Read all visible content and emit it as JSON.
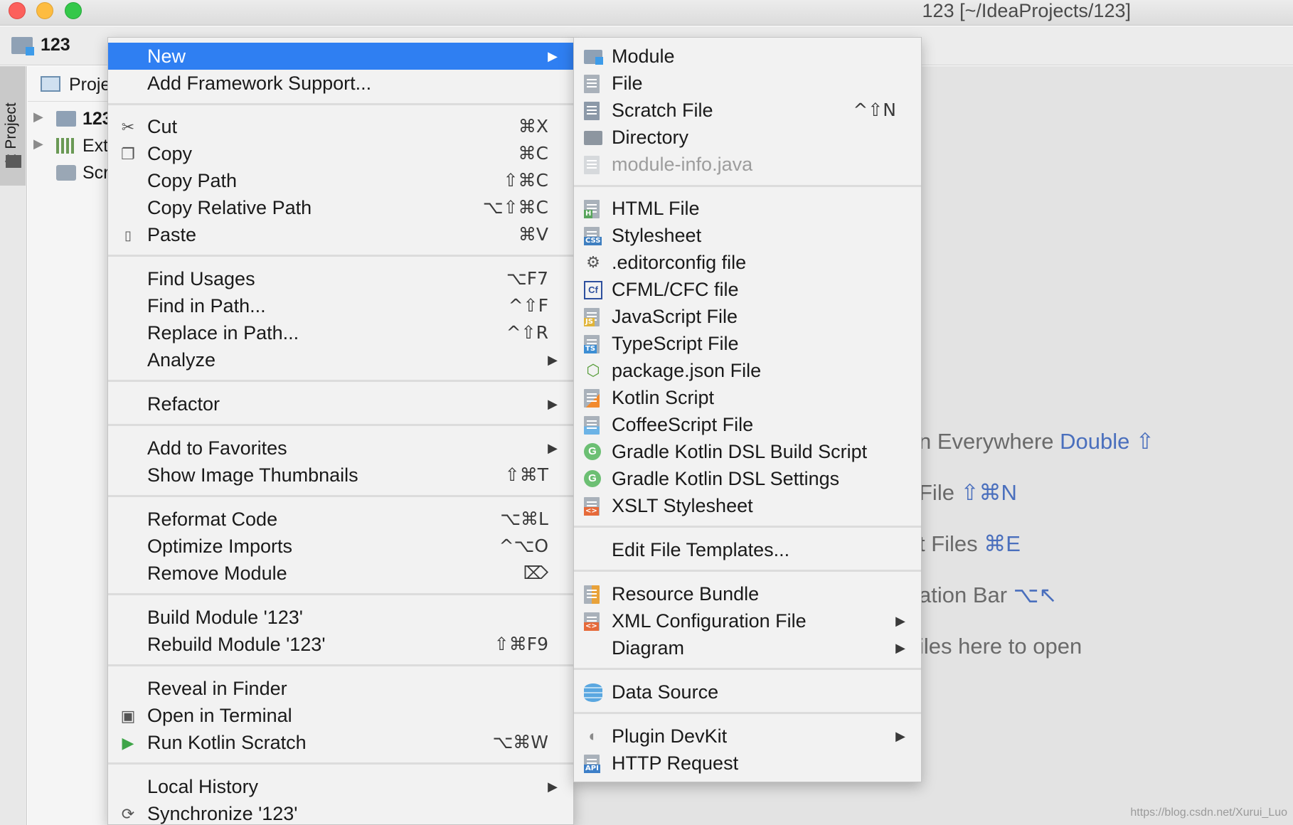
{
  "window": {
    "title": "123 [~/IdeaProjects/123]"
  },
  "navbar": {
    "project": "123"
  },
  "toolwindow": {
    "tab_label": "1: Project"
  },
  "project_panel": {
    "header": "Proje",
    "tree": [
      {
        "label": "123",
        "icon": "module-folder-icon"
      },
      {
        "label": "Ext",
        "icon": "library-icon"
      },
      {
        "label": "Scr",
        "icon": "scratch-icon"
      }
    ]
  },
  "editor_hints": [
    {
      "text": "n Everywhere ",
      "key": "Double ⇧"
    },
    {
      "text": "File ",
      "key": "⇧⌘N"
    },
    {
      "text": "t Files ",
      "key": "⌘E"
    },
    {
      "text": "ation Bar ",
      "key": "⌥↖"
    },
    {
      "text": "iles here to open",
      "key": ""
    }
  ],
  "watermark": "https://blog.csdn.net/Xurui_Luo",
  "context_menu": {
    "items": [
      {
        "label": "New",
        "shortcut": "",
        "submenu": true,
        "selected": true
      },
      {
        "label": "Add Framework Support...",
        "shortcut": ""
      },
      {
        "label": "Cut",
        "shortcut": "⌘X",
        "icon": "✂"
      },
      {
        "label": "Copy",
        "shortcut": "⌘C",
        "icon": "❐"
      },
      {
        "label": "Copy Path",
        "shortcut": "⇧⌘C"
      },
      {
        "label": "Copy Relative Path",
        "shortcut": "⌥⇧⌘C"
      },
      {
        "label": "Paste",
        "shortcut": "⌘V",
        "icon": "📋"
      },
      {
        "label": "Find Usages",
        "shortcut": "⌥F7"
      },
      {
        "label": "Find in Path...",
        "shortcut": "^⇧F"
      },
      {
        "label": "Replace in Path...",
        "shortcut": "^⇧R"
      },
      {
        "label": "Analyze",
        "shortcut": "",
        "submenu": true
      },
      {
        "label": "Refactor",
        "shortcut": "",
        "submenu": true
      },
      {
        "label": "Add to Favorites",
        "shortcut": "",
        "submenu": true
      },
      {
        "label": "Show Image Thumbnails",
        "shortcut": "⇧⌘T"
      },
      {
        "label": "Reformat Code",
        "shortcut": "⌥⌘L"
      },
      {
        "label": "Optimize Imports",
        "shortcut": "^⌥O"
      },
      {
        "label": "Remove Module",
        "shortcut": "⌦"
      },
      {
        "label": "Build Module '123'",
        "shortcut": ""
      },
      {
        "label": "Rebuild Module '123'",
        "shortcut": "⇧⌘F9"
      },
      {
        "label": "Reveal in Finder",
        "shortcut": ""
      },
      {
        "label": "Open in Terminal",
        "shortcut": "",
        "icon": "▣"
      },
      {
        "label": "Run Kotlin Scratch",
        "shortcut": "⌥⌘W",
        "icon": "▶"
      },
      {
        "label": "Local History",
        "shortcut": "",
        "submenu": true
      },
      {
        "label": "Synchronize '123'",
        "shortcut": "",
        "icon": "⟳"
      }
    ]
  },
  "new_submenu": {
    "items": [
      {
        "label": "Module",
        "icon": "module-icon"
      },
      {
        "label": "File",
        "icon": "file-icon"
      },
      {
        "label": "Scratch File",
        "shortcut": "^⇧N",
        "icon": "scratch-file-icon"
      },
      {
        "label": "Directory",
        "icon": "directory-icon"
      },
      {
        "label": "module-info.java",
        "icon": "java-file-icon",
        "disabled": true
      },
      {
        "label": "HTML File",
        "icon": "html-file-icon",
        "tag": "H"
      },
      {
        "label": "Stylesheet",
        "icon": "css-file-icon",
        "tag": "CSS"
      },
      {
        "label": ".editorconfig file",
        "icon": "editorconfig-icon"
      },
      {
        "label": "CFML/CFC file",
        "icon": "cfml-icon"
      },
      {
        "label": "JavaScript File",
        "icon": "javascript-file-icon",
        "tag": "JS"
      },
      {
        "label": "TypeScript File",
        "icon": "typescript-file-icon",
        "tag": "TS"
      },
      {
        "label": "package.json File",
        "icon": "nodejs-icon"
      },
      {
        "label": "Kotlin Script",
        "icon": "kotlin-icon"
      },
      {
        "label": "CoffeeScript File",
        "icon": "coffeescript-icon"
      },
      {
        "label": "Gradle Kotlin DSL Build Script",
        "icon": "gradle-icon"
      },
      {
        "label": "Gradle Kotlin DSL Settings",
        "icon": "gradle-icon"
      },
      {
        "label": "XSLT Stylesheet",
        "icon": "xslt-file-icon",
        "tag": "<>"
      },
      {
        "label": "Edit File Templates..."
      },
      {
        "label": "Resource Bundle",
        "icon": "resource-bundle-icon"
      },
      {
        "label": "XML Configuration File",
        "icon": "xml-file-icon",
        "tag": "<>",
        "submenu": true
      },
      {
        "label": "Diagram",
        "submenu": true
      },
      {
        "label": "Data Source",
        "icon": "database-icon"
      },
      {
        "label": "Plugin DevKit",
        "icon": "plugin-icon",
        "submenu": true
      },
      {
        "label": "HTTP Request",
        "icon": "api-file-icon",
        "tag": "API"
      }
    ]
  },
  "colors": {
    "selection": "#2f7ff2",
    "hint_key": "#4a6fbd",
    "gradle": "#6cbf73"
  }
}
